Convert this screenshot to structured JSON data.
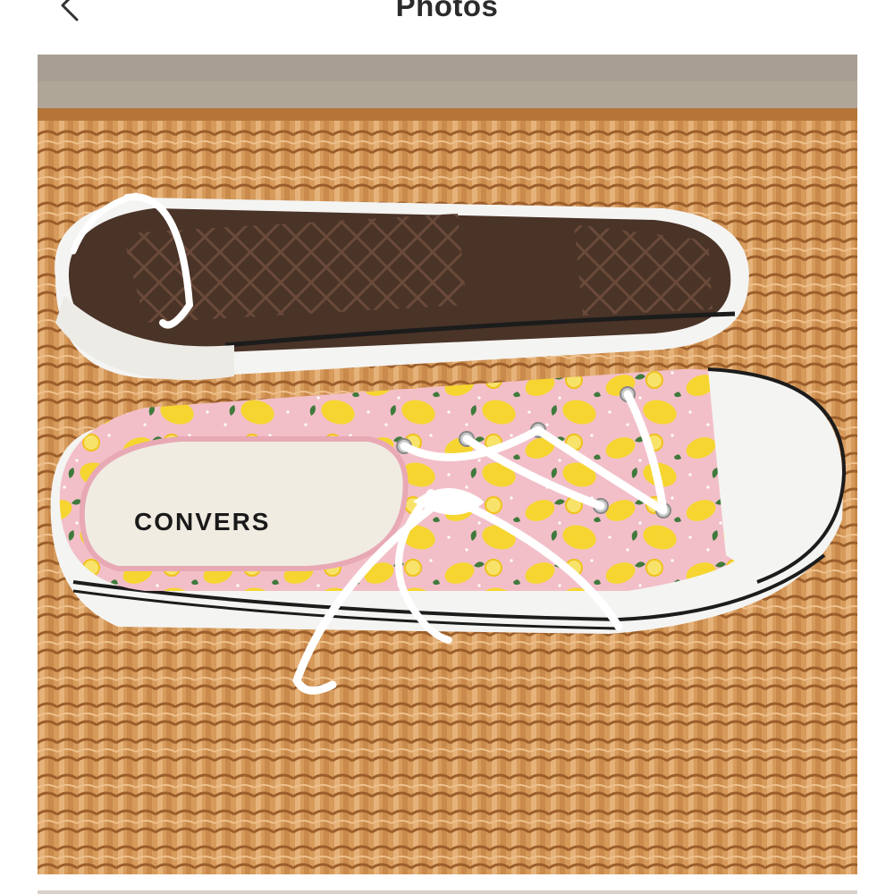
{
  "header": {
    "title": "Photos",
    "back_icon": "chevron-left-icon"
  },
  "photo": {
    "insole_brand_text": "CONVERS",
    "colors": {
      "wicker": "#d69a5b",
      "wicker_dark": "#9c5e2b",
      "canvas_pink": "#f2bfc8",
      "lemon": "#f6d530",
      "leaf": "#3f7a3c",
      "rubber_white": "#f4f4f2",
      "outsole_brown": "#4a3327",
      "stripe_black": "#1c1c1c",
      "background_wall": "#a89f92"
    }
  }
}
